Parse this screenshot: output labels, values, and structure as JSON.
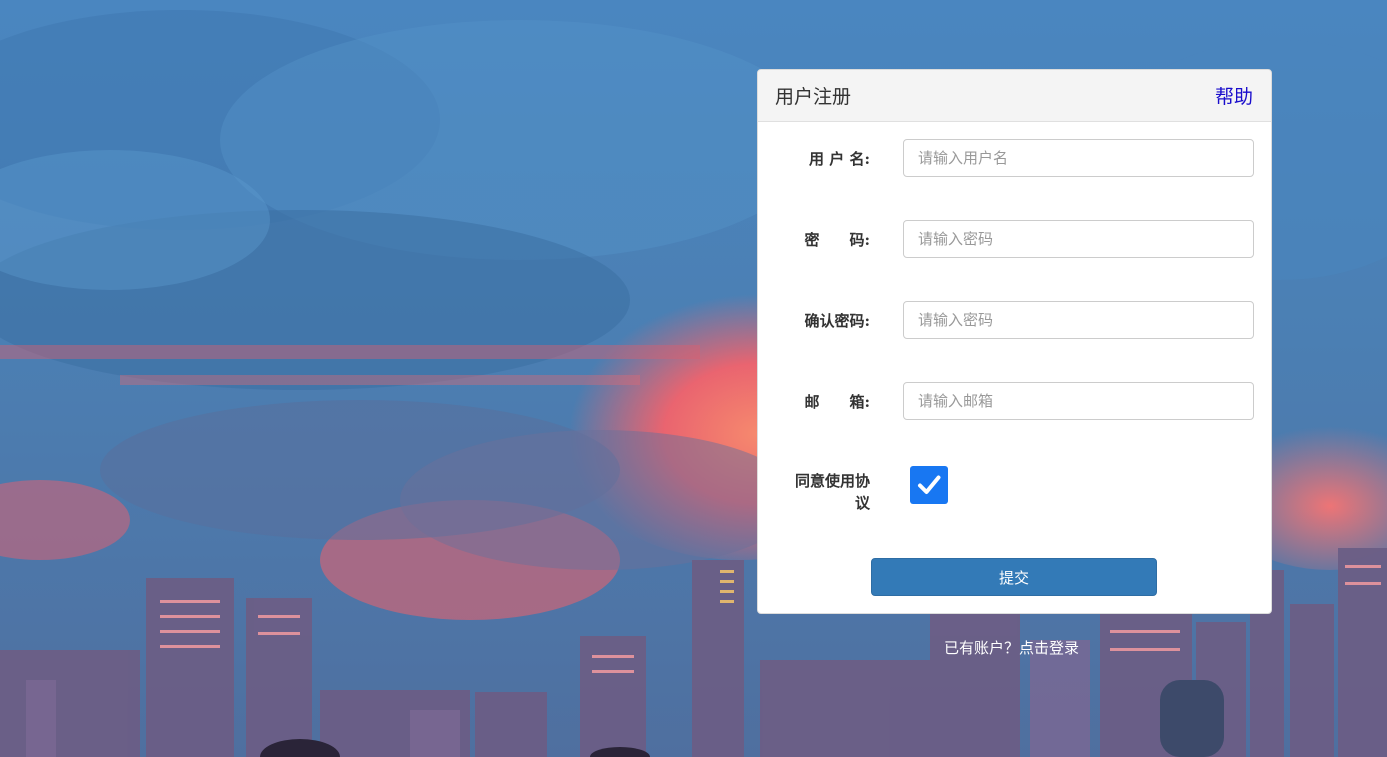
{
  "card": {
    "title": "用户注册",
    "help_link": "帮助"
  },
  "fields": [
    {
      "label": "用 户 名:",
      "placeholder": "请输入用户名",
      "value": ""
    },
    {
      "label": "密　　码:",
      "placeholder": "请输入密码",
      "value": ""
    },
    {
      "label": "确认密码:",
      "placeholder": "请输入密码",
      "value": ""
    },
    {
      "label": "邮　　箱:",
      "placeholder": "请输入邮箱",
      "value": ""
    }
  ],
  "agreement": {
    "label": "同意使用协议",
    "checked": true
  },
  "submit_label": "提交",
  "login_link": "已有账户？点击登录",
  "colors": {
    "primary_button": "#337ab7",
    "checkbox": "#1877f2",
    "help_link": "#1a0dcc",
    "sky": "#4a86c0",
    "cloud_glow": "#f0606a"
  }
}
